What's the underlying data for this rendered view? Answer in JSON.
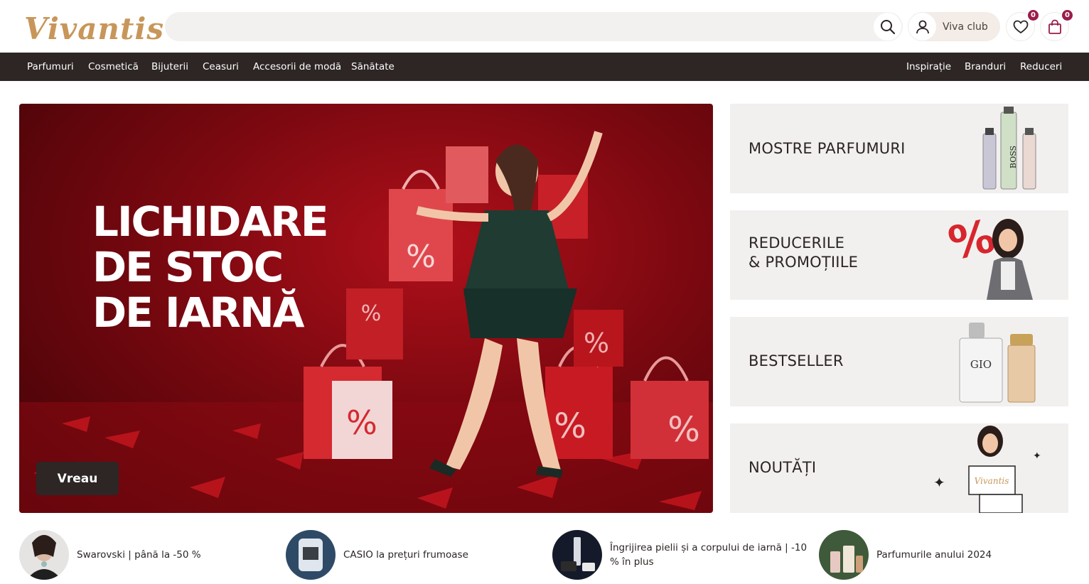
{
  "header": {
    "logo": "Vivantis",
    "search_placeholder": "",
    "club_label": "Viva club",
    "wishlist_count": "0",
    "cart_count": "0"
  },
  "nav": {
    "left": [
      "Parfumuri",
      "Cosmetică",
      "Bijuterii",
      "Ceasuri",
      "Accesorii de modă",
      "Sănătate"
    ],
    "right": [
      "Inspirație",
      "Branduri",
      "Reduceri"
    ]
  },
  "hero": {
    "title_lines": [
      "LICHIDARE",
      "DE STOC",
      "DE IARNĂ"
    ],
    "button": "Vreau"
  },
  "tiles": [
    {
      "line1": "MOSTRE PARFUMURI",
      "line2": ""
    },
    {
      "line1": "REDUCERILE",
      "line2": "& PROMOȚIILE"
    },
    {
      "line1": "BESTSELLER",
      "line2": ""
    },
    {
      "line1": "NOUTĂȚI",
      "line2": ""
    }
  ],
  "promos": [
    {
      "text_line1": "Swarovski | până la -50 %",
      "text_line2": ""
    },
    {
      "text_line1": "CASIO la prețuri frumoase",
      "text_line2": ""
    },
    {
      "text_line1": "Îngrijirea pielii și a corpului de iarnă | -10",
      "text_line2": "% în plus"
    },
    {
      "text_line1": "Parfumurile anului 2024",
      "text_line2": ""
    }
  ],
  "colors": {
    "brand_gold": "#c8965a",
    "nav_bg": "#2d2625",
    "badge": "#9b1c4a",
    "hero_red": "#b0101a"
  },
  "icons": [
    "search-icon",
    "user-icon",
    "heart-icon",
    "shopping-bag-icon"
  ]
}
